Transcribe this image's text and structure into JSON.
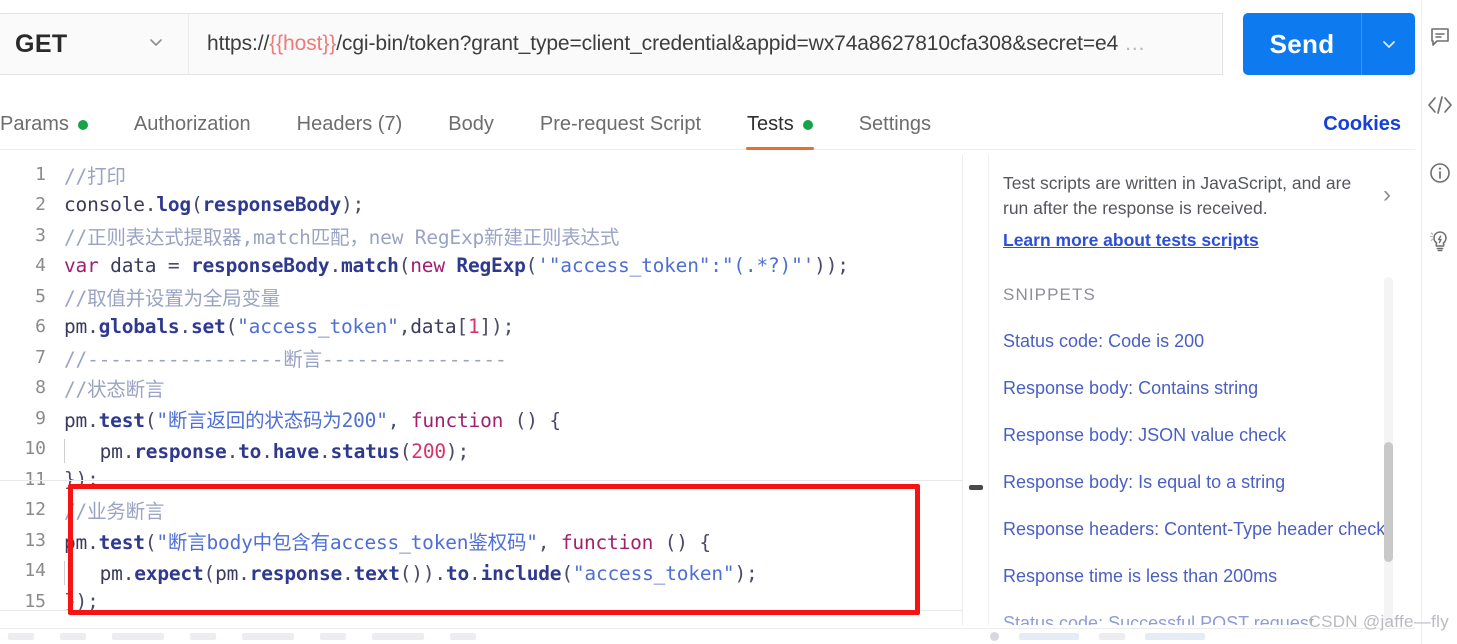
{
  "request": {
    "method": "GET",
    "url_prefix": "https://",
    "url_variable": "{{host}}",
    "url_suffix": "/cgi-bin/token?grant_type=client_credential&appid=wx74a8627810cfa308&secret=e4",
    "url_ellipsis": "…",
    "send_label": "Send",
    "method_caret": "⌄",
    "send_caret": "⌄"
  },
  "tabs": [
    {
      "label": "Params",
      "has_dot": true,
      "active": false
    },
    {
      "label": "Authorization",
      "has_dot": false,
      "active": false
    },
    {
      "label": "Headers (7)",
      "has_dot": false,
      "active": false
    },
    {
      "label": "Body",
      "has_dot": false,
      "active": false
    },
    {
      "label": "Pre-request Script",
      "has_dot": false,
      "active": false
    },
    {
      "label": "Tests",
      "has_dot": true,
      "active": true
    },
    {
      "label": "Settings",
      "has_dot": false,
      "active": false
    }
  ],
  "cookies_label": "Cookies",
  "editor": {
    "lines": [
      {
        "n": "1",
        "text": "//打印"
      },
      {
        "n": "2",
        "text": "console.log(responseBody);"
      },
      {
        "n": "3",
        "text": "//正则表达式提取器,match匹配，new RegExp新建正则表达式"
      },
      {
        "n": "4",
        "text": "var data = responseBody.match(new RegExp('\"access_token\":\"(.*?)\"'));"
      },
      {
        "n": "5",
        "text": "//取值并设置为全局变量"
      },
      {
        "n": "6",
        "text": "pm.globals.set(\"access_token\",data[1]);"
      },
      {
        "n": "7",
        "text": "//-----------------断言----------------"
      },
      {
        "n": "8",
        "text": "//状态断言"
      },
      {
        "n": "9",
        "text": "pm.test(\"断言返回的状态码为200\", function () {"
      },
      {
        "n": "10",
        "text": "    pm.response.to.have.status(200);"
      },
      {
        "n": "11",
        "text": "});"
      },
      {
        "n": "12",
        "text": "//业务断言"
      },
      {
        "n": "13",
        "text": "pm.test(\"断言body中包含有access_token鉴权码\", function () {"
      },
      {
        "n": "14",
        "text": "    pm.expect(pm.response.text()).to.include(\"access_token\");"
      },
      {
        "n": "15",
        "text": "});"
      }
    ],
    "highlight_color": "#f41414"
  },
  "snippets_panel": {
    "description": "Test scripts are written in JavaScript, and are run after the response is received.",
    "learn_more": "Learn more about tests scripts",
    "section_title": "SNIPPETS",
    "items": [
      "Status code: Code is 200",
      "Response body: Contains string",
      "Response body: JSON value check",
      "Response body: Is equal to a string",
      "Response headers: Content-Type header check",
      "Response time is less than 200ms",
      "Status code: Successful POST request"
    ],
    "expand_arrow": "›"
  },
  "rail_icons": [
    {
      "name": "comment-icon"
    },
    {
      "name": "code-icon",
      "glyph": "</>"
    },
    {
      "name": "info-icon",
      "glyph": "i"
    },
    {
      "name": "lightbulb-icon"
    }
  ],
  "watermark": "CSDN @jaffe—fly",
  "colors": {
    "accent_send": "#0d7af0",
    "tab_active_underline": "#ef6b2e",
    "status_dot": "#16a34a",
    "cookies_link": "#1640d8",
    "annotation": "#f41414"
  }
}
